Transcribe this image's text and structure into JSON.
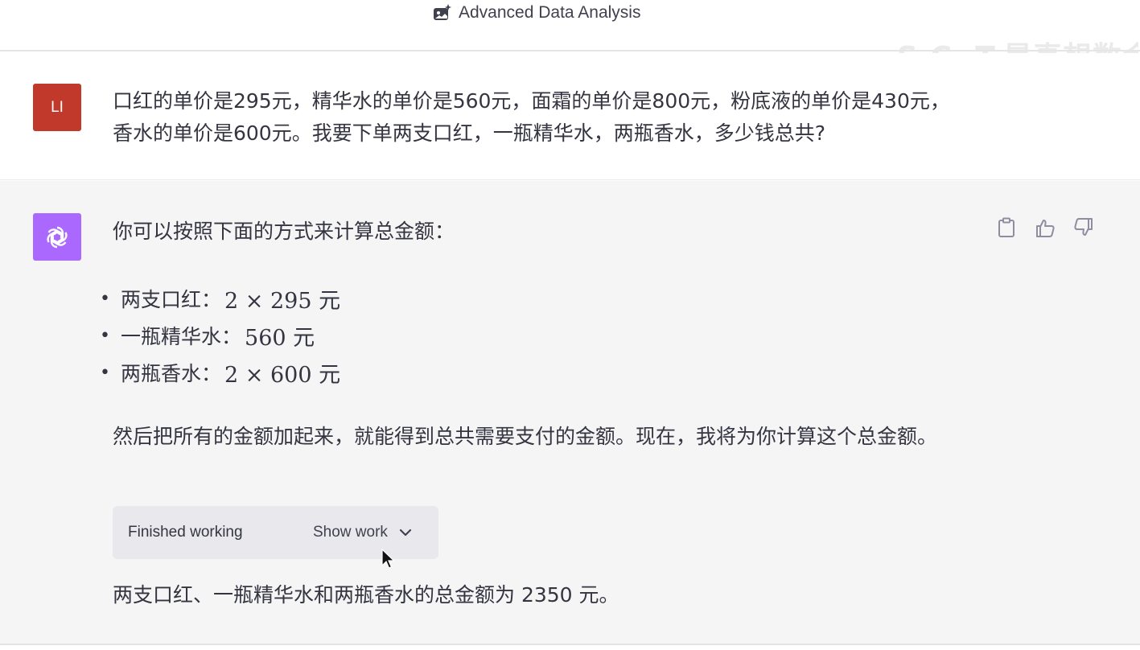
{
  "header": {
    "model_label": "Advanced Data Analysis",
    "icon": "image-sparkle-icon"
  },
  "watermark": "S.C. T.是真想数会",
  "user_message": {
    "avatar_initials": "LI",
    "avatar_color": "#c0392b",
    "text": "口红的单价是295元，精华水的单价是560元，面霜的单价是800元，粉底液的单价是430元，香水的单价是600元。我要下单两支口红，一瓶精华水，两瓶香水，多少钱总共?"
  },
  "assistant_message": {
    "avatar_color": "#ab68ff",
    "intro": "你可以按照下面的方式来计算总金额：",
    "items": [
      {
        "label": "两支口红：",
        "expr": "2 × 295 元"
      },
      {
        "label": "一瓶精华水：",
        "expr": "560 元"
      },
      {
        "label": "两瓶香水：",
        "expr": "2 × 600 元"
      }
    ],
    "paragraph": "然后把所有的金额加起来，就能得到总共需要支付的金额。现在，我将为你计算这个总金额。",
    "work_status": "Finished working",
    "show_work_label": "Show work",
    "answer": "两支口红、一瓶精华水和两瓶香水的总金额为 2350 元。",
    "actions": [
      "clipboard-icon",
      "thumbs-up-icon",
      "thumbs-down-icon"
    ]
  }
}
